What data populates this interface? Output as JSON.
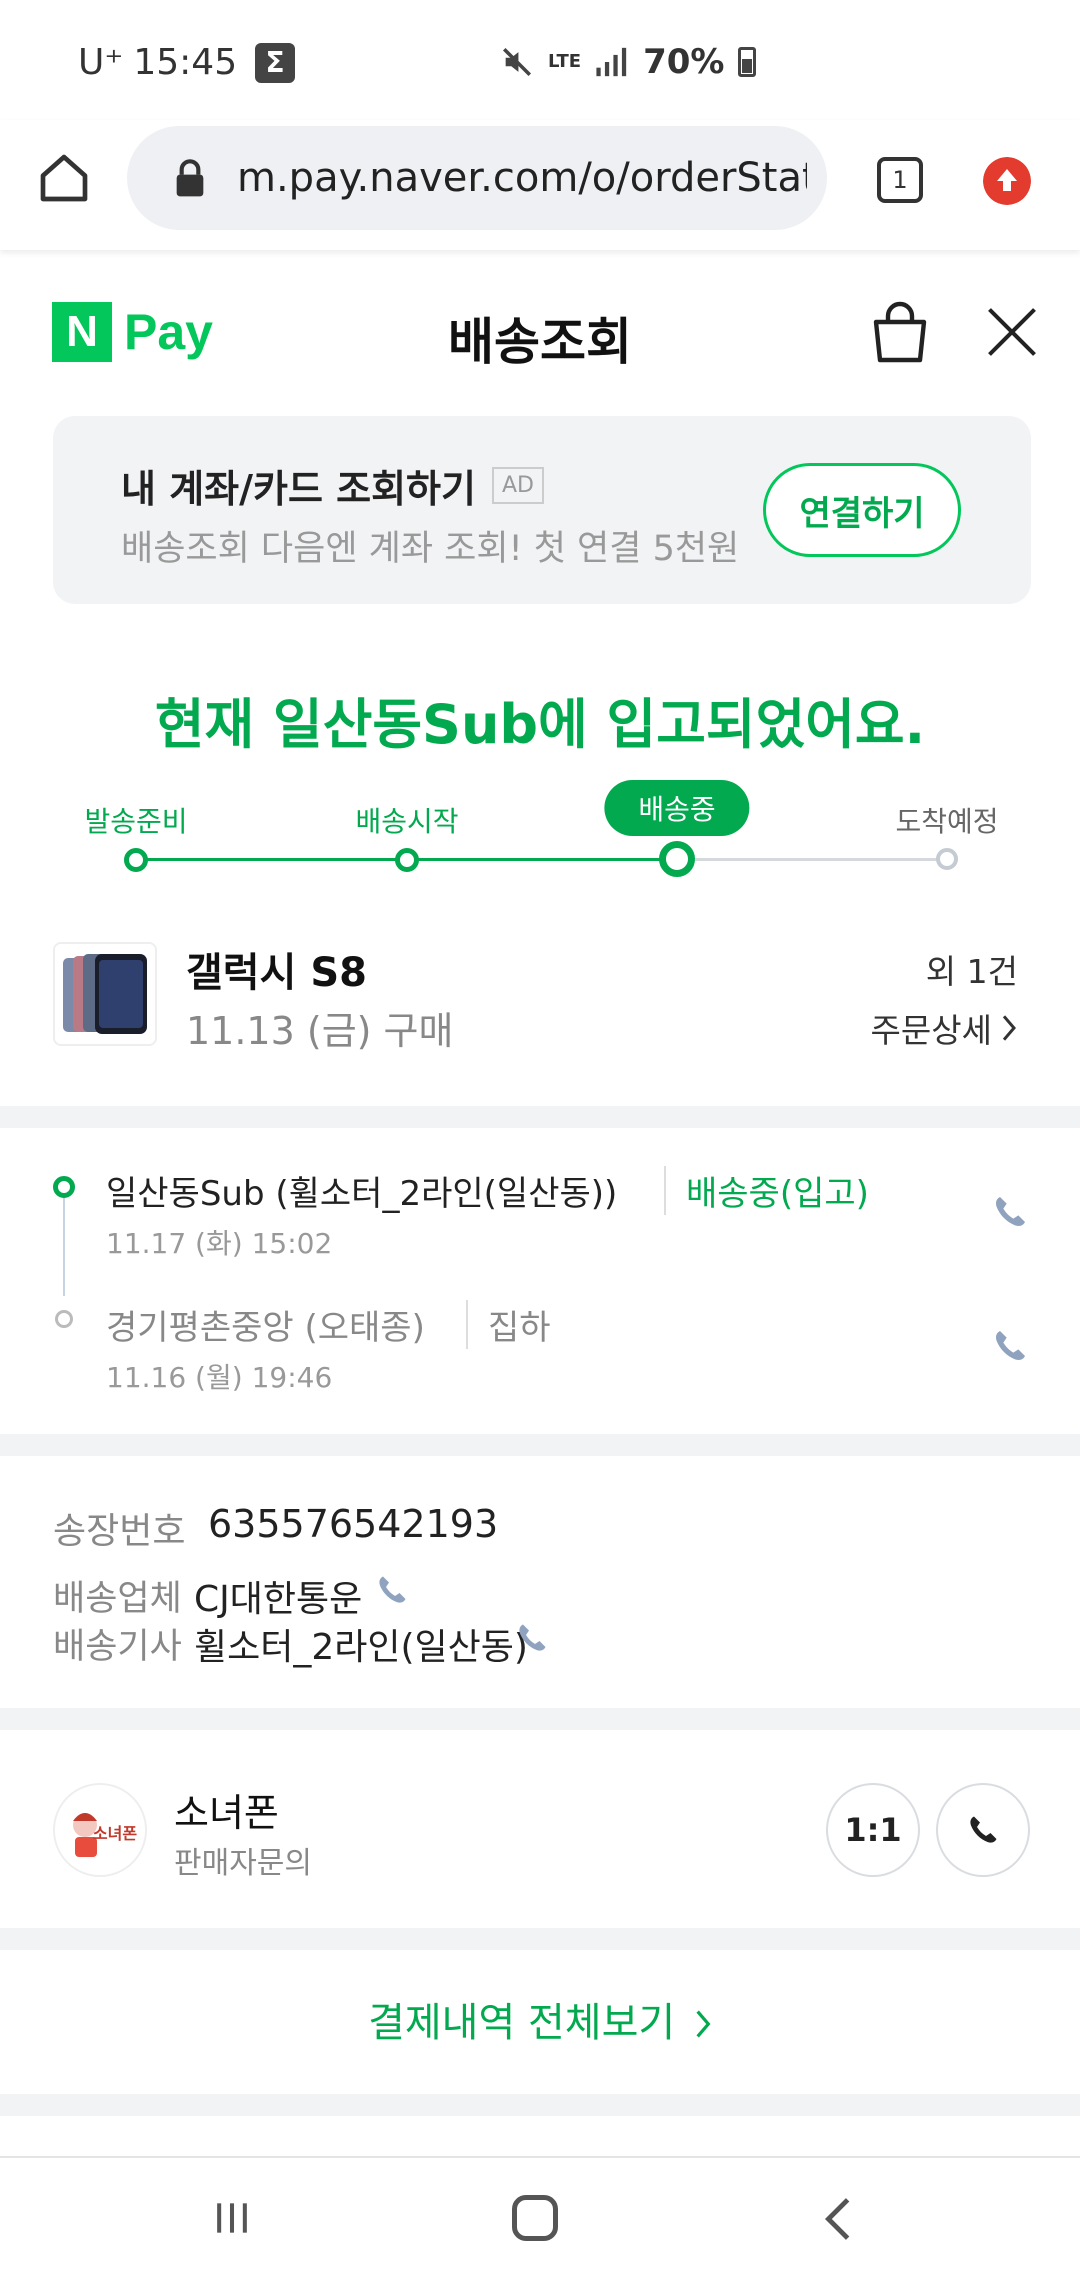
{
  "status_bar": {
    "carrier": "U⁺",
    "time": "15:45",
    "notification_icon": "sigma-icon",
    "icons": [
      "mute-icon",
      "lte-icon",
      "signal-icon"
    ],
    "lte_label": "LTE",
    "battery": "70%"
  },
  "browser": {
    "url": "m.pay.naver.com/o/orderStat",
    "tab_count": "1"
  },
  "header": {
    "logo_n": "N",
    "logo_pay": "Pay",
    "title": "배송조회"
  },
  "ad_banner": {
    "title": "내 계좌/카드 조회하기",
    "badge": "AD",
    "subtitle": "배송조회 다음엔 계좌 조회! 첫 연결 5천원",
    "button": "연결하기"
  },
  "headline": "현재 일산동Sub에 입고되었어요.",
  "progress": {
    "steps": [
      {
        "label": "발송준비",
        "state": "done"
      },
      {
        "label": "배송시작",
        "state": "done"
      },
      {
        "label": "배송중",
        "state": "current"
      },
      {
        "label": "도착예정",
        "state": "pending"
      }
    ]
  },
  "product": {
    "name": "갤럭시 S8",
    "purchase_date": "11.13 (금) 구매",
    "extra_count": "외 1건",
    "detail_link": "주문상세"
  },
  "tracking": [
    {
      "place": "일산동Sub (휠소터_2라인(일산동))",
      "status": "배송중(입고)",
      "time": "11.17 (화) 15:02"
    },
    {
      "place": "경기평촌중앙 (오태종)",
      "status": "집하",
      "time": "11.16 (월) 19:46"
    }
  ],
  "shipment_info": {
    "invoice_label": "송장번호",
    "invoice_number": "635576542193",
    "carrier_label": "배송업체",
    "carrier_name": "CJ대한통운",
    "driver_label": "배송기사",
    "driver_name": "휠소터_2라인(일산동)"
  },
  "seller": {
    "avatar_text": "소녀폰",
    "name": "소녀폰",
    "subtitle": "판매자문의",
    "chat_button": "1:1"
  },
  "all_payments": "결제내역 전체보기",
  "colors": {
    "brand_green": "#03c75a",
    "text_green": "#03a94f",
    "divider": "#f2f3f5"
  }
}
